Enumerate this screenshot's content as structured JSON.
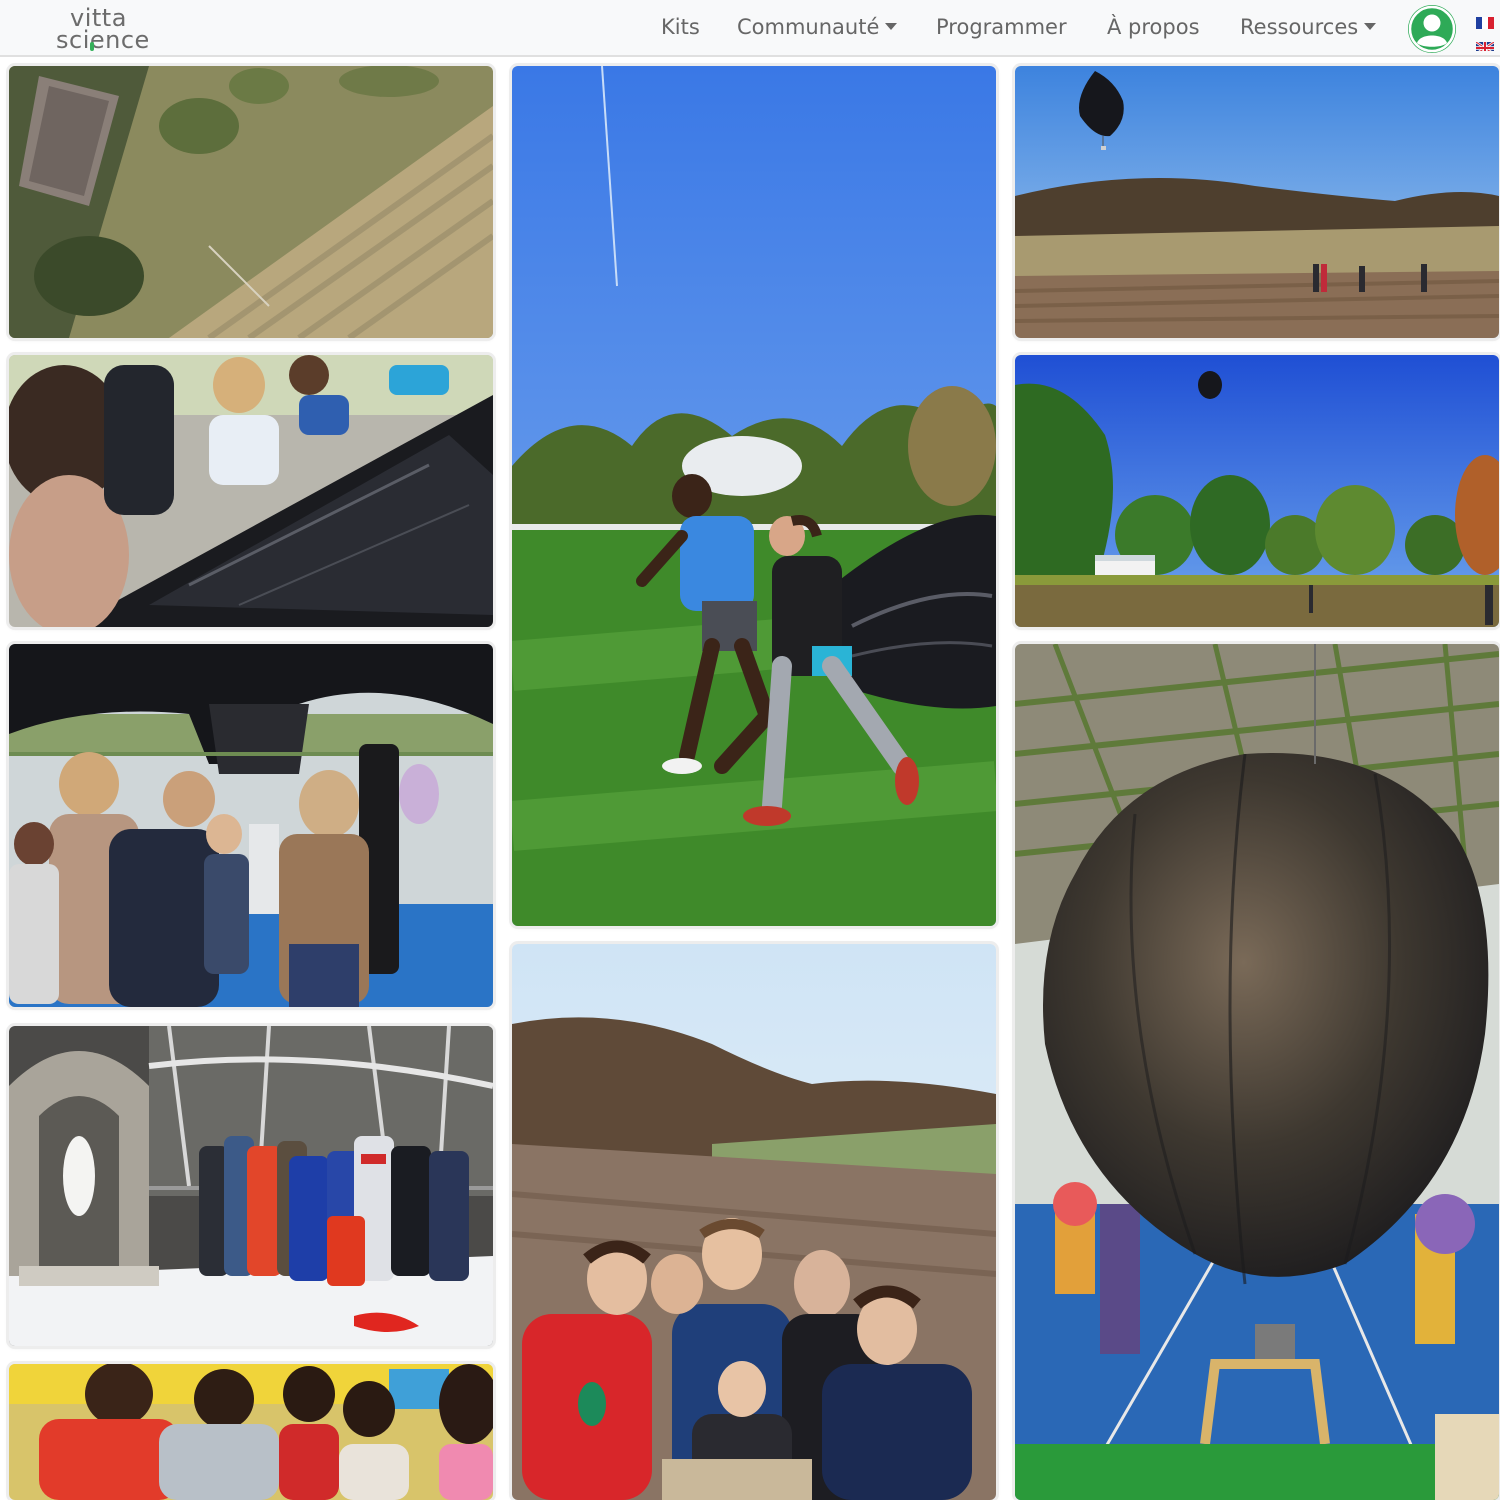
{
  "brand": {
    "line1": "vitta",
    "line2": "science"
  },
  "nav": {
    "kits": "Kits",
    "communaute": "Communauté",
    "programmer": "Programmer",
    "apropos": "À propos",
    "ressources": "Ressources"
  },
  "account": {
    "icon": "user-account-icon"
  },
  "languages": [
    {
      "code": "fr",
      "icon": "flag-fr-icon"
    },
    {
      "code": "en",
      "icon": "flag-uk-icon"
    }
  ],
  "colors": {
    "accent": "#2eaa57",
    "nav_text": "#666666",
    "navbar_bg": "#f8f9fa",
    "sky": "#3f7fe0",
    "grass": "#3f8a2a",
    "balloon": "#1e1e22"
  },
  "gallery": {
    "photos": [
      {
        "name": "photo-aerial-farmland",
        "subject": "aerial view of a house and mown field"
      },
      {
        "name": "photo-children-taping-plastic",
        "subject": "children assembling a black plastic balloon on the floor"
      },
      {
        "name": "photo-children-under-balloon",
        "subject": "children under a black balloon in a gym"
      },
      {
        "name": "photo-group-in-snow",
        "subject": "group photo in snow beside a stone shrine"
      },
      {
        "name": "photo-classroom-children",
        "subject": "children gathered in a classroom"
      },
      {
        "name": "photo-runners-with-balloon",
        "subject": "two people running with a black balloon on a field"
      },
      {
        "name": "photo-family-in-field",
        "subject": "family group in a plowed field"
      },
      {
        "name": "photo-balloon-over-hills",
        "subject": "black balloon floating over hills"
      },
      {
        "name": "photo-balloon-over-park",
        "subject": "black balloon in a blue sky above a park"
      },
      {
        "name": "photo-balloon-in-gym",
        "subject": "large black balloon inflated inside a gymnasium"
      }
    ]
  }
}
